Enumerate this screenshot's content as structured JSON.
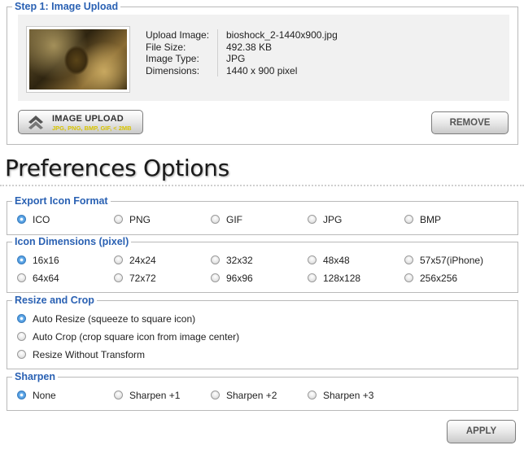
{
  "upload": {
    "legend": "Step 1: Image Upload",
    "info": [
      {
        "label": "Upload Image:",
        "value": "bioshock_2-1440x900.jpg"
      },
      {
        "label": "File Size:",
        "value": "492.38 KB"
      },
      {
        "label": "Image Type:",
        "value": "JPG"
      },
      {
        "label": "Dimensions:",
        "value": "1440 x 900 pixel"
      }
    ],
    "upload_button": {
      "label": "IMAGE UPLOAD",
      "sub": "JPG, PNG, BMP, GIF, < 2MB"
    },
    "remove_button": "REMOVE"
  },
  "preferences": {
    "title": "Preferences Options",
    "export_format": {
      "legend": "Export Icon Format",
      "options": [
        "ICO",
        "PNG",
        "GIF",
        "JPG",
        "BMP"
      ],
      "selected": "ICO"
    },
    "dimensions": {
      "legend": "Icon Dimensions (pixel)",
      "options": [
        "16x16",
        "24x24",
        "32x32",
        "48x48",
        "57x57(iPhone)",
        "64x64",
        "72x72",
        "96x96",
        "128x128",
        "256x256"
      ],
      "selected": "16x16"
    },
    "resize": {
      "legend": "Resize and Crop",
      "options": [
        "Auto Resize (squeeze to square icon)",
        "Auto Crop (crop square icon from image center)",
        "Resize Without Transform"
      ],
      "selected": "Auto Resize (squeeze to square icon)"
    },
    "sharpen": {
      "legend": "Sharpen",
      "options": [
        "None",
        "Sharpen +1",
        "Sharpen +2",
        "Sharpen +3"
      ],
      "selected": "None"
    },
    "apply_button": "APPLY"
  },
  "colors": {
    "legend": "#2a61b3",
    "radio_selected": "#2f7ed0",
    "panel_bg": "#f1f1f1"
  },
  "icons": {
    "upload": "double-chevron-up-icon",
    "radio": "radio-button-icon"
  }
}
